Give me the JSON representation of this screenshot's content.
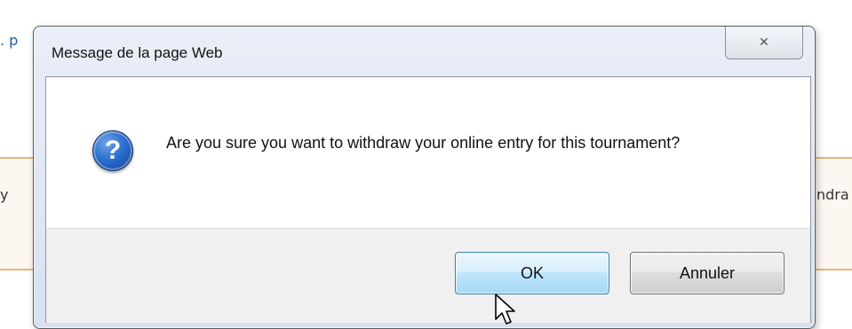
{
  "background_page": {
    "left_fragment_nav": ". p",
    "left_fragment_band": "y",
    "right_fragment_band": "ndra"
  },
  "dialog": {
    "title": "Message de la page Web",
    "close_icon": "close-x-icon",
    "message": "Are you sure you want to withdraw your online entry for this tournament?",
    "icon": "question-icon",
    "icon_glyph": "?",
    "close_glyph": "✕",
    "buttons": {
      "ok": "OK",
      "cancel": "Annuler"
    }
  }
}
